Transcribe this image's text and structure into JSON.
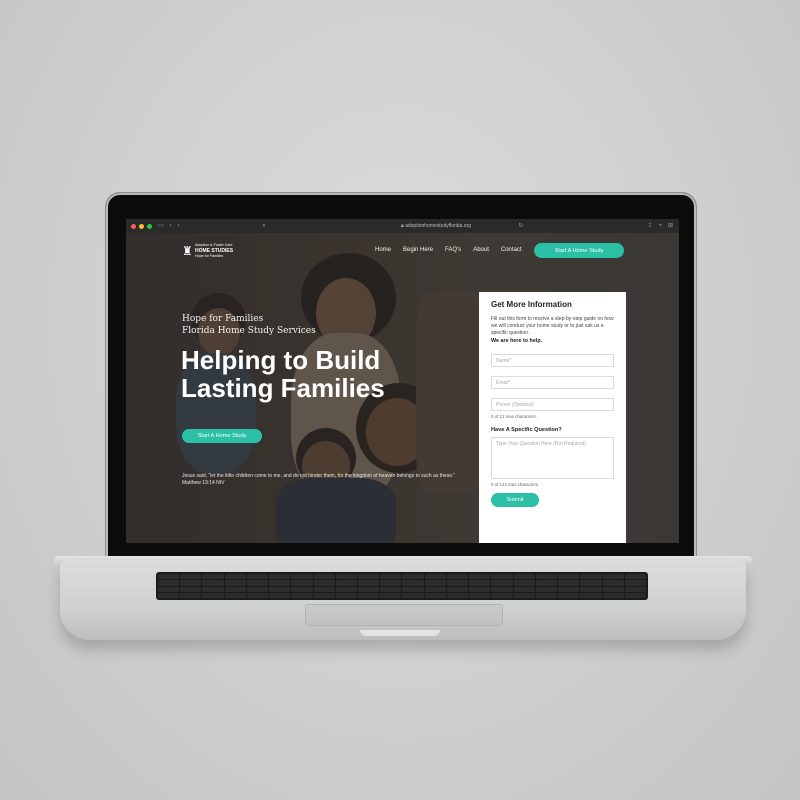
{
  "browser": {
    "url": "adoptionhomestudyflorida.org"
  },
  "logo": {
    "line1": "Adoption & Foster Care",
    "line2": "HOME STUDIES",
    "line3": "Hope for Families"
  },
  "nav": {
    "items": [
      "Home",
      "Begin Here",
      "FAQ's",
      "About",
      "Contact"
    ],
    "cta": "Start A Home Study"
  },
  "hero": {
    "tagline_1": "Hope for Families",
    "tagline_2": "Florida Home Study Services",
    "headline": "Helping to Build Lasting Families",
    "cta": "Start A Home Study",
    "verse": "Jesus said, \"let the little children come to me, and do not hinder them, for the kingdom of heaven belongs to such as these.\" Matthew 19:14 NIV"
  },
  "form": {
    "title": "Get More Information",
    "intro": "Fill out this form to receive a step-by-step guide on how we will conduct your home study or to just ask us a specific question.",
    "here_to_help": "We are here to help.",
    "name_placeholder": "Name*",
    "email_placeholder": "Email*",
    "phone_placeholder": "Phone (Optional)",
    "phone_hint": "0 of 12 max characters.",
    "question_label": "Have A Specific Question?",
    "question_placeholder": "Type Your Question Here (Not Required)",
    "question_hint": "0 of 144 max characters.",
    "submit": "Submit"
  },
  "colors": {
    "accent": "#2bbfa6"
  }
}
